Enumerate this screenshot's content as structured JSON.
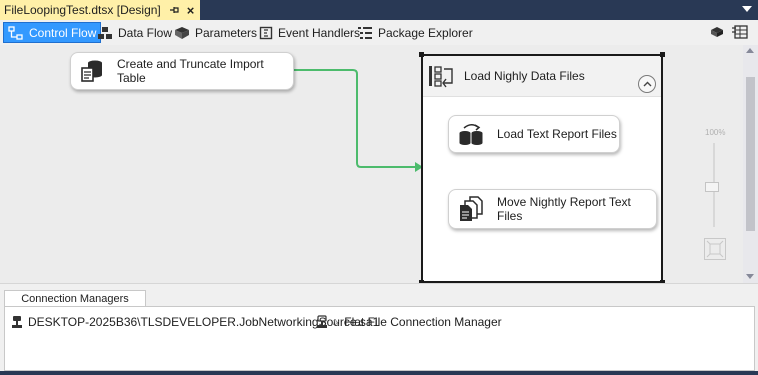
{
  "document_tab": {
    "title": "FileLoopingTest.dtsx [Design]",
    "pin_icon": "pin-icon",
    "close_icon": "close-icon"
  },
  "toolbar": {
    "tabs": [
      {
        "label": "Control Flow",
        "icon": "control-flow-icon",
        "active": true
      },
      {
        "label": "Data Flow",
        "icon": "data-flow-icon",
        "active": false
      },
      {
        "label": "Parameters",
        "icon": "parameters-icon",
        "active": false
      },
      {
        "label": "Event Handlers",
        "icon": "event-handlers-icon",
        "active": false
      },
      {
        "label": "Package Explorer",
        "icon": "package-explorer-icon",
        "active": false
      }
    ],
    "right_icons": [
      "toolbox-icon",
      "variables-icon"
    ]
  },
  "canvas": {
    "tasks": [
      {
        "label": "Create and Truncate Import Table",
        "icon": "sql-task-icon"
      },
      {
        "label": "Load Text Report Files",
        "icon": "data-flow-task-icon"
      },
      {
        "label": "Move Nightly Report Text Files",
        "icon": "file-system-task-icon"
      }
    ],
    "container": {
      "title": "Load Nighly Data Files",
      "icon": "foreach-loop-icon",
      "collapse_icon": "collapse-chevron-icon"
    },
    "zoom": {
      "label": "100%",
      "level_percent": 100
    }
  },
  "connection_managers": {
    "tab_label": "Connection Managers",
    "items": [
      {
        "label": "DESKTOP-2025B36\\TLSDEVELOPER.JobNetworkingSource.sa1",
        "icon": "oledb-connection-icon"
      },
      {
        "label": "Flat File Connection Manager",
        "icon": "flat-file-connection-icon",
        "prefix": "fx"
      }
    ]
  },
  "colors": {
    "chrome": "#293955",
    "active_tab": "#fff0a8",
    "selected_tool": "#3399ff",
    "precedence_green": "#4cbb6c"
  }
}
